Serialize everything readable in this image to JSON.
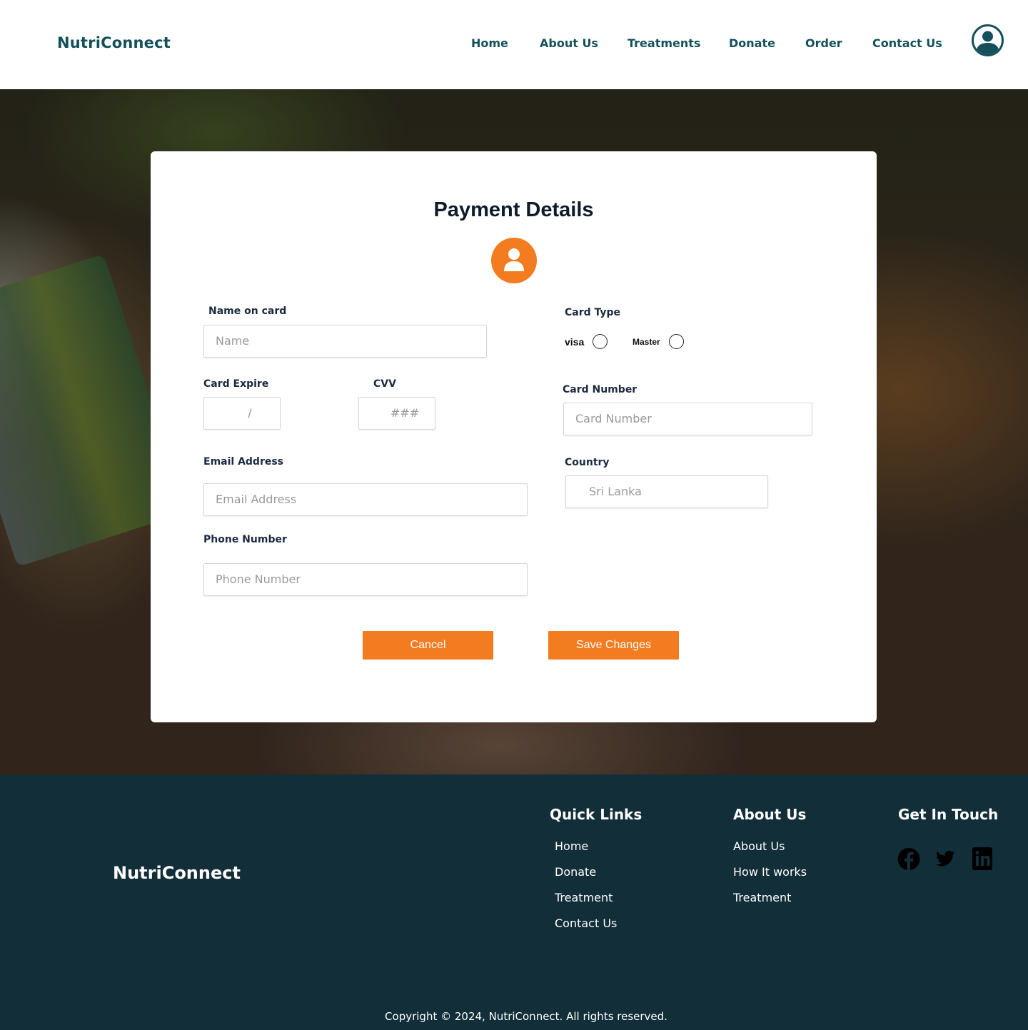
{
  "header": {
    "logo": "NutriConnect",
    "nav": [
      "Home",
      "About Us",
      "Treatments",
      "Donate",
      "Order",
      "Contact Us"
    ]
  },
  "form": {
    "title": "Payment Details",
    "name_on_card": {
      "label": "Name on card",
      "placeholder": "Name"
    },
    "card_type": {
      "label": "Card Type",
      "options": [
        "visa",
        "Master"
      ]
    },
    "card_expire": {
      "label": "Card Expire",
      "placeholder": "/"
    },
    "cvv": {
      "label": "CVV",
      "placeholder": "###"
    },
    "card_number": {
      "label": "Card Number",
      "placeholder": "Card Number"
    },
    "email": {
      "label": "Email Address",
      "placeholder": "Email Address"
    },
    "country": {
      "label": "Country",
      "value": "Sri Lanka"
    },
    "phone": {
      "label": "Phone Number",
      "placeholder": "Phone Number"
    },
    "cancel_label": "Cancel",
    "save_label": "Save Changes"
  },
  "footer": {
    "logo": "NutriConnect",
    "quick_links": {
      "heading": "Quick Links",
      "items": [
        "Home",
        "Donate",
        "Treatment",
        "Contact Us"
      ]
    },
    "about": {
      "heading": "About Us",
      "items": [
        "About Us",
        "How It works",
        "Treatment"
      ]
    },
    "contact": {
      "heading": "Get In Touch",
      "icons": [
        "facebook-icon",
        "twitter-icon",
        "linkedin-icon"
      ]
    },
    "copyright": "Copyright © 2024, NutriConnect. All rights reserved."
  },
  "colors": {
    "brand": "#14505a",
    "accent": "#f47c20",
    "footer_bg": "#122e38"
  }
}
